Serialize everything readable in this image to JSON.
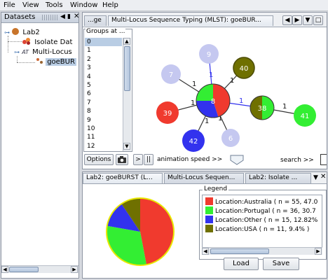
{
  "menu": [
    "File",
    "View",
    "Tools",
    "Window",
    "Help"
  ],
  "datasets_panel": {
    "title": "Datasets",
    "tree": {
      "root": "Lab2",
      "isolate": "Isolate Dat",
      "mlst": "Multi-Locus",
      "goeburst": "goeBUR"
    }
  },
  "top_tabs": {
    "tab1": "...ge",
    "tab2": "Multi-Locus Sequence Typing (MLST): goeBUR..."
  },
  "groups": {
    "title": "Groups at ...",
    "items": [
      "0",
      "1",
      "2",
      "3",
      "4",
      "5",
      "6",
      "7",
      "8",
      "9",
      "10",
      "11",
      "12"
    ],
    "selected": "0"
  },
  "graph": {
    "edge_labels": [
      "1",
      "1",
      "1",
      "1",
      "1",
      "1",
      "1",
      "1"
    ],
    "nodes": [
      {
        "label": "9"
      },
      {
        "label": "7"
      },
      {
        "label": "40"
      },
      {
        "label": "8"
      },
      {
        "label": "38"
      },
      {
        "label": "39"
      },
      {
        "label": "41"
      },
      {
        "label": "42"
      },
      {
        "label": "6"
      }
    ]
  },
  "toolbar": {
    "options": "Options",
    "play": ">",
    "pause": "||",
    "animation_speed": "animation speed >>",
    "search": "search >>"
  },
  "bottom_tabs": {
    "tab1": "Lab2: goeBURST (L...",
    "tab2": "Multi-Locus Sequen...",
    "tab3": "Lab2: Isolate ..."
  },
  "legend": {
    "title": "Legend",
    "items": [
      {
        "label": "Location:Australia ( n = 55, 47.0",
        "color": "#f03a2e"
      },
      {
        "label": "Location:Portugal ( n = 36, 30.7",
        "color": "#33ee33"
      },
      {
        "label": "Location:Other ( n = 15, 12.82%",
        "color": "#3232ee"
      },
      {
        "label": "Location:USA ( n = 11, 9.4% )",
        "color": "#6f7000"
      }
    ],
    "load": "Load",
    "save": "Save"
  },
  "chart_data": {
    "type": "pie",
    "categories": [
      "Location:Australia",
      "Location:Portugal",
      "Location:Other",
      "Location:USA"
    ],
    "values": [
      55,
      36,
      15,
      11
    ],
    "colors": [
      "#f03a2e",
      "#33ee33",
      "#3232ee",
      "#6f7000"
    ]
  }
}
